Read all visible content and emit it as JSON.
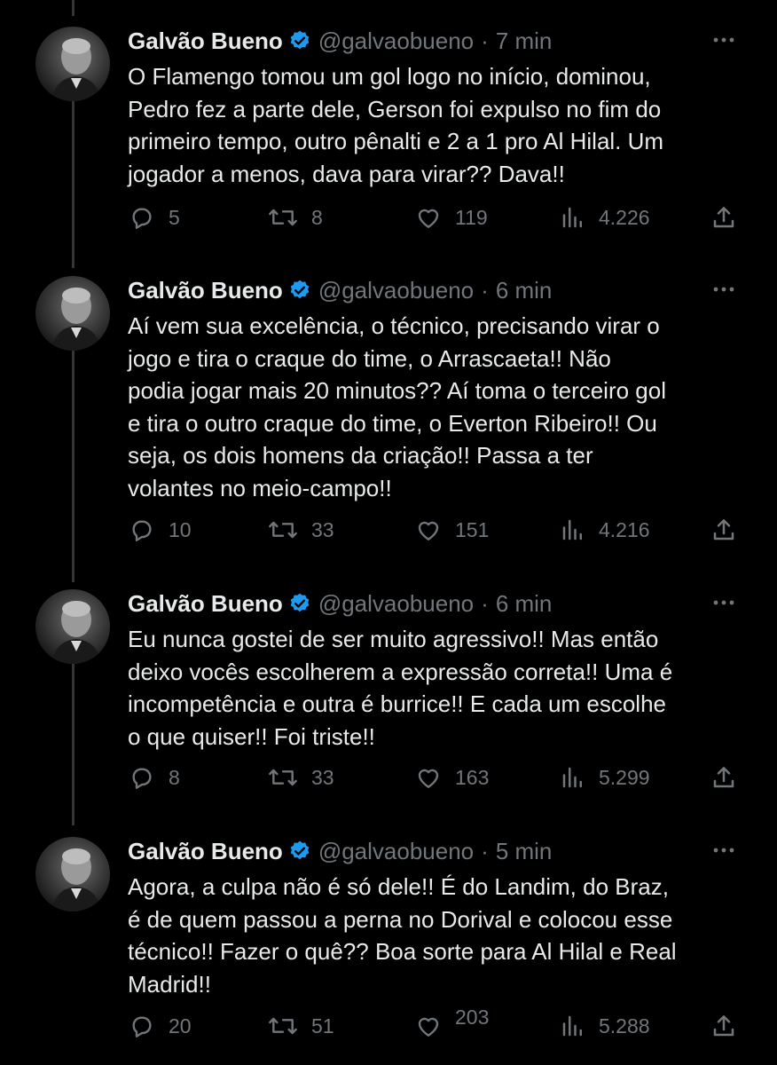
{
  "author": {
    "name": "Galvão Bueno",
    "handle": "@galvaobueno",
    "separator": "·"
  },
  "colors": {
    "background": "#000000",
    "text": "#e7e9ea",
    "secondary": "#71767b",
    "verified": "#1d9bf0",
    "thread_line": "#333639"
  },
  "tweets": [
    {
      "time": "7 min",
      "text": "O Flamengo tomou um gol logo no início, dominou,\nPedro fez a parte dele, Gerson foi expulso no fim do\nprimeiro tempo, outro pênalti e 2 a 1 pro Al Hilal. Um\njogador a menos, dava para virar?? Dava!!",
      "replies": "5",
      "retweets": "8",
      "likes": "119",
      "views": "4.226"
    },
    {
      "time": "6 min",
      "text": "Aí vem sua excelência, o técnico, precisando virar o\njogo e tira o craque do time, o Arrascaeta!! Não\npodia jogar mais 20 minutos?? Aí toma o terceiro gol\ne tira o outro craque do time, o Everton Ribeiro!! Ou\nseja, os dois homens da criação!! Passa a ter\nvolantes no meio-campo!!",
      "replies": "10",
      "retweets": "33",
      "likes": "151",
      "views": "4.216"
    },
    {
      "time": "6 min",
      "text": "Eu nunca gostei de ser muito agressivo!! Mas então\ndeixo vocês escolherem a expressão correta!! Uma é\nincompetência e outra é burrice!! E cada um escolhe\no que quiser!! Foi triste!!",
      "replies": "8",
      "retweets": "33",
      "likes": "163",
      "views": "5.299"
    },
    {
      "time": "5 min",
      "text": "Agora, a culpa não é só dele!! É do Landim, do Braz,\né de quem passou a perna no Dorival e colocou esse\ntécnico!! Fazer o quê?? Boa sorte para Al Hilal e Real\nMadrid!!",
      "replies": "20",
      "retweets": "51",
      "likes": "203",
      "views": "5.288"
    }
  ]
}
